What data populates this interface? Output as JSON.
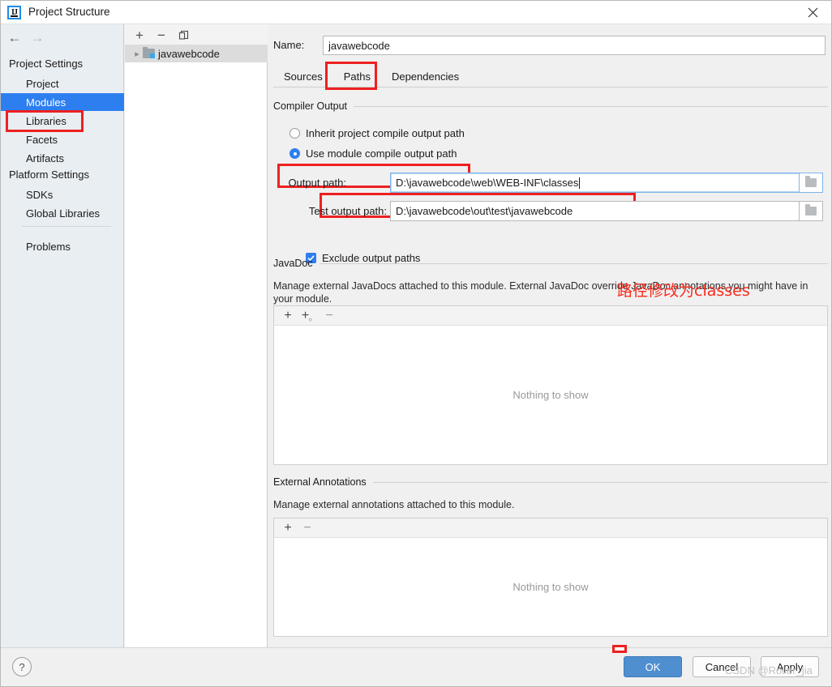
{
  "window": {
    "title": "Project Structure",
    "app_icon": "intellij-idea-icon",
    "close_label": "✕"
  },
  "sidebar": {
    "nav": {
      "back_icon": "←",
      "forward_icon": "→"
    },
    "groups": [
      {
        "label": "Project Settings",
        "items": [
          {
            "label": "Project",
            "selected": false
          },
          {
            "label": "Modules",
            "selected": true
          },
          {
            "label": "Libraries",
            "selected": false
          },
          {
            "label": "Facets",
            "selected": false
          },
          {
            "label": "Artifacts",
            "selected": false
          }
        ]
      },
      {
        "label": "Platform Settings",
        "items": [
          {
            "label": "SDKs",
            "selected": false
          },
          {
            "label": "Global Libraries",
            "selected": false
          }
        ]
      }
    ],
    "problems": {
      "label": "Problems"
    }
  },
  "tree_panel": {
    "toolbar": {
      "add": "+",
      "remove": "−",
      "copy": "copy-icon"
    },
    "rows": [
      {
        "label": "javawebcode",
        "expanded": false,
        "selected": true
      }
    ]
  },
  "main": {
    "name": {
      "label": "Name:",
      "value": "javawebcode",
      "placeholder": ""
    },
    "tabs": [
      {
        "label": "Sources",
        "active": false
      },
      {
        "label": "Paths",
        "active": true
      },
      {
        "label": "Dependencies",
        "active": false
      }
    ],
    "compiler_output": {
      "group_label": "Compiler Output",
      "options": [
        {
          "label": "Inherit project compile output path",
          "selected": false
        },
        {
          "label": "Use module compile output path",
          "selected": true
        }
      ],
      "output_path": {
        "label": "Output path:",
        "value": "D:\\javawebcode\\web\\WEB-INF\\classes",
        "focused": true,
        "browse_icon": "folder-icon"
      },
      "test_output_path": {
        "label": "Test output path:",
        "value": "D:\\javawebcode\\out\\test\\javawebcode",
        "focused": false,
        "browse_icon": "folder-icon"
      },
      "exclude": {
        "label": "Exclude output paths",
        "checked": true
      }
    },
    "javadoc": {
      "group_label": "JavaDoc",
      "description": "Manage external JavaDocs attached to this module. External JavaDoc override JavaDoc annotations you might have in your module.",
      "toolbar": {
        "add": "+",
        "add_special": "+",
        "remove": "−"
      },
      "empty_text": "Nothing to show"
    },
    "external_annotations": {
      "group_label": "External Annotations",
      "description": "Manage external annotations attached to this module.",
      "toolbar": {
        "add": "+",
        "remove": "−"
      },
      "empty_text": "Nothing to show"
    }
  },
  "annotations": {
    "chinese_note": "路径修改为classes",
    "note_color": "#fb2a1c",
    "highlight_color": "#ee2020"
  },
  "footer": {
    "help_label": "?",
    "ok_label": "OK",
    "cancel_label": "Cancel",
    "apply_label": "Apply",
    "watermark": "CSDN @Roller_jia"
  },
  "colors": {
    "accent": "#2d7ff0",
    "selection": "#2d7ff0",
    "ok_button": "#4f8fd0",
    "sidebar_bg": "#e9eef2",
    "panel_bg": "#f0f0f0"
  }
}
